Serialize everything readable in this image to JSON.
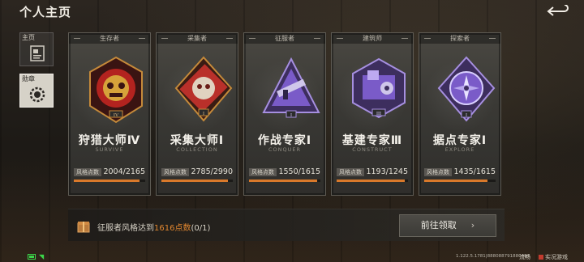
{
  "header": {
    "title": "个人主页"
  },
  "sidebar": {
    "tabs": [
      {
        "label": "主页",
        "icon": "profile-card-icon",
        "active": false
      },
      {
        "label": "勋章",
        "icon": "medal-gear-icon",
        "active": true
      }
    ]
  },
  "cards": [
    {
      "category": "生存者",
      "title": "狩猎大师Ⅳ",
      "subtitle": "SURVIVE",
      "points_label": "风格点数",
      "points": "2004/2165",
      "progress": 0.926,
      "emblem": "hunter-skull-emblem-icon",
      "color": "#c9302c"
    },
    {
      "category": "采集者",
      "title": "采集大师Ⅰ",
      "subtitle": "COLLECTION",
      "points_label": "风格点数",
      "points": "2785/2990",
      "progress": 0.931,
      "emblem": "collector-mask-emblem-icon",
      "color": "#c9302c"
    },
    {
      "category": "征服者",
      "title": "作战专家Ⅰ",
      "subtitle": "CONQUER",
      "points_label": "风格点数",
      "points": "1550/1615",
      "progress": 0.96,
      "emblem": "conquer-gun-emblem-icon",
      "color": "#7a5bc8"
    },
    {
      "category": "建筑师",
      "title": "基建专家Ⅲ",
      "subtitle": "CONSTRUCT",
      "points_label": "风格点数",
      "points": "1193/1245",
      "progress": 0.958,
      "emblem": "construct-machine-emblem-icon",
      "color": "#7a5bc8"
    },
    {
      "category": "探索者",
      "title": "据点专家Ⅰ",
      "subtitle": "EXPLORE",
      "points_label": "风格点数",
      "points": "1435/1615",
      "progress": 0.889,
      "emblem": "explore-compass-emblem-icon",
      "color": "#7a5bc8"
    }
  ],
  "task": {
    "text_prefix": "征服者风格达到",
    "text_highlight": "1616点数",
    "text_suffix": "(0/1)",
    "button_label": "前往领取",
    "button_chevron": "›"
  },
  "status": {
    "version": "1.122.5.1781|888088791880494",
    "network": "流畅",
    "realname": "实况游戏"
  }
}
